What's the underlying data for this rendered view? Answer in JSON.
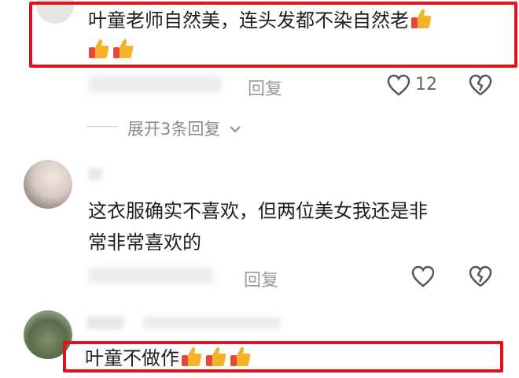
{
  "comments": [
    {
      "text": "叶童老师自然美，连头发都不染自然老",
      "thumbs_inline": 1,
      "thumbs_second_line": 2,
      "reply_label": "回复",
      "like_count": "12"
    },
    {
      "expand_replies": "展开3条回复"
    },
    {
      "text_line1": "这衣服确实不喜欢，但两位美女我还是非",
      "text_line2": "常非常喜欢的",
      "reply_label": "回复"
    },
    {
      "text": "叶童不做作",
      "thumbs": 3
    }
  ],
  "colors": {
    "highlight_box": "#e0121b",
    "thumb_yellow": "#f6b32a",
    "thumb_red_sleeve": "#e8473c"
  }
}
